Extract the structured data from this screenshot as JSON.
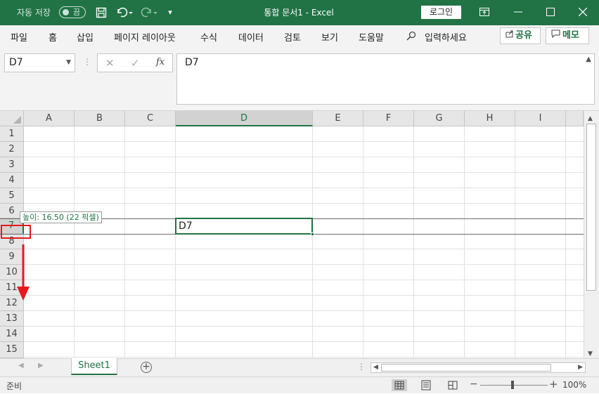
{
  "titlebar": {
    "autosave_label": "자동 저장",
    "autosave_state": "끔",
    "doc_title": "통합 문서1  -  Excel",
    "login_label": "로그인"
  },
  "ribbon": {
    "tabs": [
      "파일",
      "홈",
      "삽입",
      "페이지 레이아웃",
      "수식",
      "데이터",
      "검토",
      "보기",
      "도움말"
    ],
    "search_placeholder": "입력하세요",
    "share_label": "공유",
    "memo_label": "메모"
  },
  "formula": {
    "namebox": "D7",
    "content": "D7"
  },
  "grid": {
    "columns": [
      "A",
      "B",
      "C",
      "D",
      "E",
      "F",
      "G",
      "H",
      "I"
    ],
    "selected_column": "D",
    "rows": [
      "1",
      "2",
      "3",
      "4",
      "5",
      "6",
      "7",
      "8",
      "9",
      "10",
      "11",
      "12",
      "13",
      "14",
      "15"
    ],
    "selected_row": "7",
    "active_cell_value": "D7",
    "resize_tooltip": "높이: 16.50 (22 픽셀)"
  },
  "sheets": {
    "tabs": [
      "Sheet1"
    ]
  },
  "status": {
    "text": "준비",
    "zoom": "100%"
  },
  "colors": {
    "accent": "#217346",
    "annotation": "#e8191c"
  }
}
